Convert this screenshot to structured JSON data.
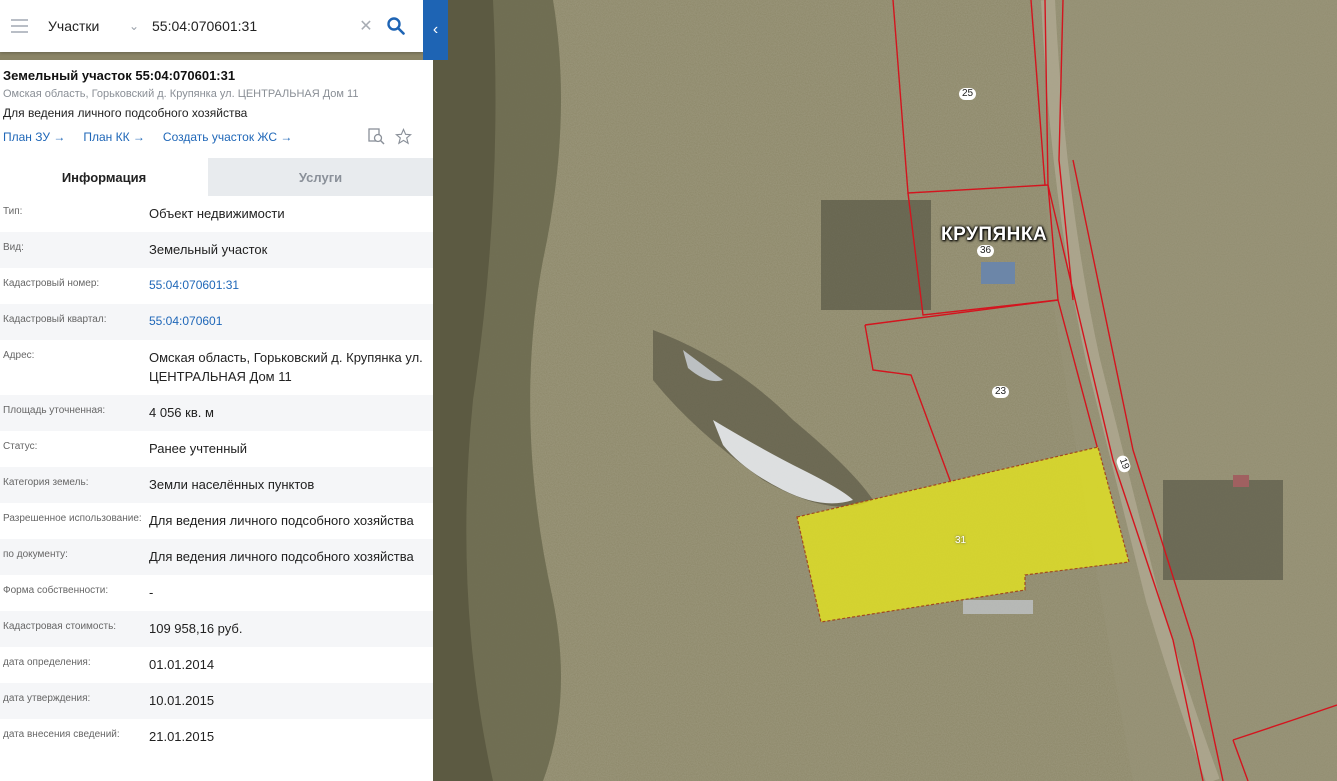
{
  "search": {
    "type_label": "Участки",
    "query": "55:04:070601:31"
  },
  "panel": {
    "title": "Земельный участок 55:04:070601:31",
    "address": "Омская область, Горьковский д. Крупянка ул. ЦЕНТРАЛЬНАЯ Дом 11",
    "usage": "Для ведения личного подсобного хозяйства",
    "links": [
      "План ЗУ →",
      "План КК →",
      "Создать участок ЖС →"
    ],
    "tabs": {
      "info": "Информация",
      "services": "Услуги"
    },
    "rows": [
      {
        "label": "Тип:",
        "value": "Объект недвижимости"
      },
      {
        "label": "Вид:",
        "value": "Земельный участок"
      },
      {
        "label": "Кадастровый номер:",
        "value": "55:04:070601:31"
      },
      {
        "label": "Кадастровый квартал:",
        "value": "55:04:070601"
      },
      {
        "label": "Адрес:",
        "value": "Омская область, Горьковский д. Крупянка ул. ЦЕНТРАЛЬНАЯ Дом 11"
      },
      {
        "label": "Площадь уточненная:",
        "value": "4 056 кв. м"
      },
      {
        "label": "Статус:",
        "value": "Ранее учтенный"
      },
      {
        "label": "Категория земель:",
        "value": "Земли населённых пунктов"
      },
      {
        "label": "Разрешенное использование:",
        "value": "Для ведения личного подсобного хозяйства"
      },
      {
        "label": "по документу:",
        "value": "Для ведения личного подсобного хозяйства"
      },
      {
        "label": "Форма собственности:",
        "value": "-"
      },
      {
        "label": "Кадастровая стоимость:",
        "value": "109 958,16 руб."
      },
      {
        "label": "дата определения:",
        "value": "01.01.2014"
      },
      {
        "label": "дата утверждения:",
        "value": "10.01.2015"
      },
      {
        "label": "дата внесения сведений:",
        "value": "21.01.2015"
      }
    ]
  },
  "map": {
    "town_label": "КРУПЯНКА",
    "plot_numbers": [
      "25",
      "36",
      "23",
      "31",
      "19"
    ],
    "selected_plot": "31",
    "colors": {
      "boundary": "#d4141e",
      "selected_fill": "#e6e61e",
      "accent": "#1e64b4"
    }
  },
  "icons": [
    "menu-icon",
    "chevron-down-icon",
    "close-icon",
    "search-icon",
    "chevron-left-icon",
    "search-on-map-icon",
    "star-icon"
  ]
}
